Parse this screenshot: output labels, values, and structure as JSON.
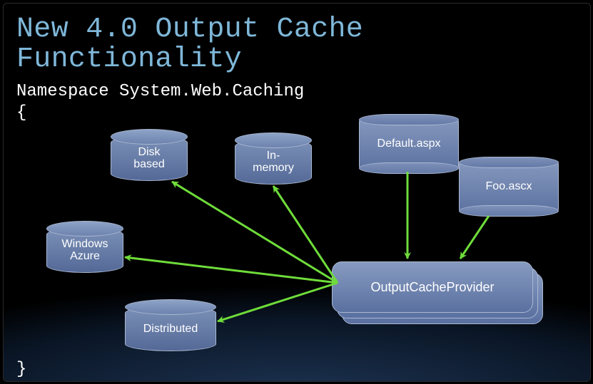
{
  "title": "New 4.0 Output Cache\nFunctionality",
  "namespace": "Namespace System.Web.Caching",
  "brace_open": "{",
  "brace_close": "}",
  "cylinders": {
    "disk": "Disk\nbased",
    "inmemory": "In-\nmemory",
    "azure": "Windows\nAzure",
    "distributed": "Distributed"
  },
  "scrolls": {
    "default_aspx": "Default.aspx",
    "foo_ascx": "Foo.ascx"
  },
  "provider": "OutputCacheProvider",
  "colors": {
    "title": "#7fb7d9",
    "arrow": "#6fdc3a",
    "node_fill_top": "#8497bd",
    "node_fill_bottom": "#5d73a1",
    "node_border": "#aab8d3"
  }
}
